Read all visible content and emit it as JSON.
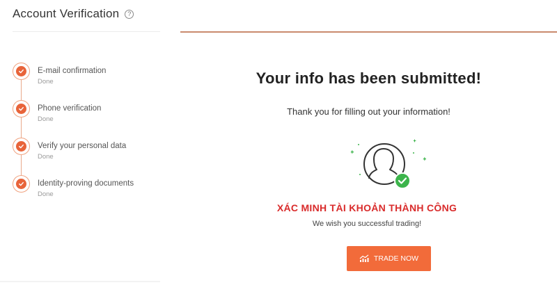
{
  "sidebar": {
    "title": "Account Verification",
    "help_icon": "?",
    "steps": [
      {
        "label": "E-mail confirmation",
        "status": "Done"
      },
      {
        "label": "Phone verification",
        "status": "Done"
      },
      {
        "label": "Verify your personal data",
        "status": "Done"
      },
      {
        "label": "Identity-proving documents",
        "status": "Done"
      }
    ]
  },
  "main": {
    "title": "Your info has been submitted!",
    "thank_you": "Thank you for filling out your information!",
    "success_heading": "XÁC MINH TÀI KHOẢN THÀNH CÔNG",
    "wish": "We wish you successful trading!",
    "cta_label": "TRADE NOW"
  },
  "colors": {
    "accent": "#f26b3a",
    "step_check": "#e8643a",
    "success_text": "#d92b2b",
    "verified_badge": "#3cb44b"
  }
}
